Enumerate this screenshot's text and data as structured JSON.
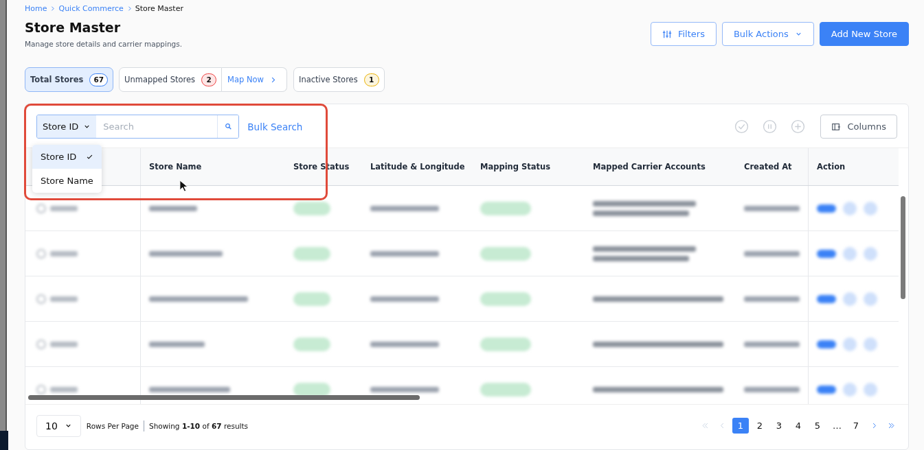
{
  "breadcrumb": [
    {
      "label": "Home",
      "link": true
    },
    {
      "label": "Quick Commerce",
      "link": true
    },
    {
      "label": "Store Master",
      "link": false
    }
  ],
  "page": {
    "title": "Store Master",
    "subtitle": "Manage store details and carrier mappings."
  },
  "header_buttons": [
    {
      "label": "Filters",
      "kind": "filter"
    },
    {
      "label": "Bulk Actions",
      "kind": "dropdown"
    },
    {
      "label": "Add New Store",
      "kind": "primary"
    }
  ],
  "summary_chips": [
    {
      "label": "Total Stores",
      "count": "67",
      "color": "#3b82f6",
      "selected": true
    },
    {
      "label": "Unmapped Stores",
      "count": "2",
      "color": "#ef4444",
      "selected": false,
      "action": "Map Now"
    },
    {
      "label": "Inactive Stores",
      "count": "1",
      "color": "#eab308",
      "selected": false
    }
  ],
  "search": {
    "field_selector": "Store ID",
    "placeholder": "Search",
    "bulk_link": "Bulk Search"
  },
  "search_dropdown": {
    "expanded": true,
    "options": [
      {
        "label": "Store ID",
        "selected": true
      },
      {
        "label": "Store Name",
        "selected": false
      }
    ]
  },
  "toolbar_actions": [
    {
      "kind": "check",
      "disabled": true
    },
    {
      "kind": "pause",
      "disabled": true
    },
    {
      "kind": "add",
      "disabled": true
    },
    {
      "kind": "columns",
      "label": "Columns",
      "disabled": false
    }
  ],
  "table": {
    "columns": [
      "",
      "Store Name",
      "Store Status",
      "Latitude & Longitude",
      "Mapping Status",
      "Mapped Carrier Accounts",
      "Created At",
      "Action"
    ],
    "rows": [
      {
        "blurred": true
      },
      {
        "blurred": true
      },
      {
        "blurred": true
      },
      {
        "blurred": true
      },
      {
        "blurred": true
      }
    ]
  },
  "pagination": {
    "rows_per_page": "10",
    "rows_label": "Rows Per Page",
    "summary": "Showing **1-10** of **67** results",
    "pages": [
      {
        "label": "1",
        "selected": true
      },
      {
        "label": "2",
        "selected": false
      },
      {
        "label": "3",
        "selected": false
      },
      {
        "label": "4",
        "selected": false
      },
      {
        "label": "5",
        "selected": false
      },
      {
        "label": "…",
        "selected": false
      },
      {
        "label": "7",
        "selected": false
      }
    ],
    "prev_disabled": true,
    "next_disabled": false
  },
  "annotation": {
    "kind": "highlight-box"
  },
  "cursor": {
    "kind": "arrow"
  }
}
